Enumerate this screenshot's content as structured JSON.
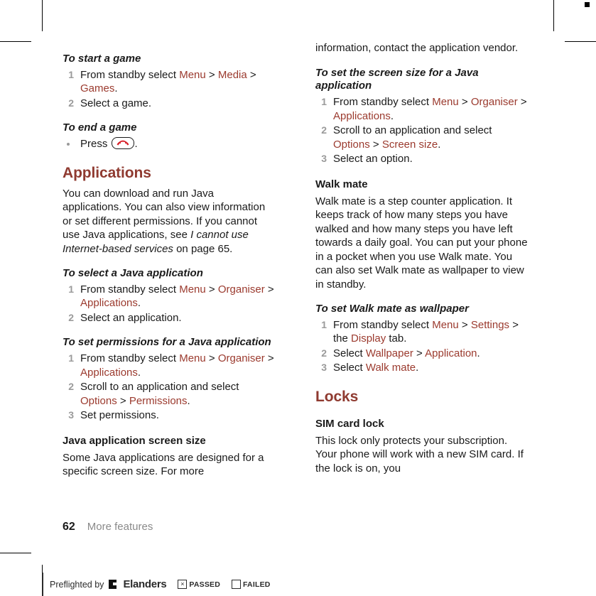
{
  "document": {
    "accent_color": "#9b3a2e",
    "heading_color": "#8f3a30",
    "step_number_color": "#9a9a9a"
  },
  "left_column": {
    "proc_start_game": {
      "title": "To start a game",
      "steps": [
        {
          "num": "1",
          "parts": [
            {
              "t": "From standby select ",
              "s": "plain"
            },
            {
              "t": "Menu",
              "s": "accent"
            },
            {
              "t": " > ",
              "s": "plain"
            },
            {
              "t": "Media",
              "s": "accent"
            },
            {
              "t": " > ",
              "s": "plain"
            },
            {
              "t": "Games",
              "s": "accent"
            },
            {
              "t": ".",
              "s": "plain"
            }
          ]
        },
        {
          "num": "2",
          "parts": [
            {
              "t": "Select a game.",
              "s": "plain"
            }
          ]
        }
      ]
    },
    "proc_end_game": {
      "title": "To end a game",
      "bullet_prefix": "Press ",
      "bullet_suffix": ".",
      "key_icon": "end-call-key-icon"
    },
    "applications_heading": "Applications",
    "applications_body": [
      {
        "t": "You can download and run Java applications. You can also view information or set different permissions. If you cannot use Java applications, see ",
        "s": "plain"
      },
      {
        "t": "I cannot use Internet-based services",
        "s": "italic"
      },
      {
        "t": " on page 65.",
        "s": "plain"
      }
    ],
    "proc_select_java": {
      "title": "To select a Java application",
      "steps": [
        {
          "num": "1",
          "parts": [
            {
              "t": "From standby select ",
              "s": "plain"
            },
            {
              "t": "Menu",
              "s": "accent"
            },
            {
              "t": " > ",
              "s": "plain"
            },
            {
              "t": "Organiser",
              "s": "accent"
            },
            {
              "t": " > ",
              "s": "plain"
            },
            {
              "t": "Applications",
              "s": "accent"
            },
            {
              "t": ".",
              "s": "plain"
            }
          ]
        },
        {
          "num": "2",
          "parts": [
            {
              "t": "Select an application.",
              "s": "plain"
            }
          ]
        }
      ]
    },
    "proc_set_permissions": {
      "title": "To set permissions for a Java application",
      "steps": [
        {
          "num": "1",
          "parts": [
            {
              "t": "From standby select ",
              "s": "plain"
            },
            {
              "t": "Menu",
              "s": "accent"
            },
            {
              "t": " > ",
              "s": "plain"
            },
            {
              "t": "Organiser",
              "s": "accent"
            },
            {
              "t": " > ",
              "s": "plain"
            },
            {
              "t": "Applications",
              "s": "accent"
            },
            {
              "t": ".",
              "s": "plain"
            }
          ]
        },
        {
          "num": "2",
          "parts": [
            {
              "t": "Scroll to an application and select ",
              "s": "plain"
            },
            {
              "t": "Options",
              "s": "accent"
            },
            {
              "t": " > ",
              "s": "plain"
            },
            {
              "t": "Permissions",
              "s": "accent"
            },
            {
              "t": ".",
              "s": "plain"
            }
          ]
        },
        {
          "num": "3",
          "parts": [
            {
              "t": "Set permissions.",
              "s": "plain"
            }
          ]
        }
      ]
    },
    "screen_size_heading": "Java application screen size",
    "screen_size_body": [
      {
        "t": "Some Java applications are designed for a specific screen size. For more",
        "s": "plain"
      }
    ]
  },
  "right_column": {
    "continuation_body": [
      {
        "t": "information, contact the application vendor.",
        "s": "plain"
      }
    ],
    "proc_set_screen_size": {
      "title": "To set the screen size for a Java application",
      "steps": [
        {
          "num": "1",
          "parts": [
            {
              "t": "From standby select ",
              "s": "plain"
            },
            {
              "t": "Menu",
              "s": "accent"
            },
            {
              "t": " > ",
              "s": "plain"
            },
            {
              "t": "Organiser",
              "s": "accent"
            },
            {
              "t": " > ",
              "s": "plain"
            },
            {
              "t": "Applications",
              "s": "accent"
            },
            {
              "t": ".",
              "s": "plain"
            }
          ]
        },
        {
          "num": "2",
          "parts": [
            {
              "t": "Scroll to an application and select ",
              "s": "plain"
            },
            {
              "t": "Options",
              "s": "accent"
            },
            {
              "t": " > ",
              "s": "plain"
            },
            {
              "t": "Screen size",
              "s": "accent"
            },
            {
              "t": ".",
              "s": "plain"
            }
          ]
        },
        {
          "num": "3",
          "parts": [
            {
              "t": "Select an option.",
              "s": "plain"
            }
          ]
        }
      ]
    },
    "walk_mate_heading": "Walk mate",
    "walk_mate_body": [
      {
        "t": "Walk mate is a step counter application. It keeps track of how many steps you have walked and how many steps you have left towards a daily goal. You can put your phone in a pocket when you use Walk mate. You can also set Walk mate as wallpaper to view in standby.",
        "s": "plain"
      }
    ],
    "proc_walk_mate_wallpaper": {
      "title": "To set Walk mate as wallpaper",
      "steps": [
        {
          "num": "1",
          "parts": [
            {
              "t": "From standby select ",
              "s": "plain"
            },
            {
              "t": "Menu",
              "s": "accent"
            },
            {
              "t": " > ",
              "s": "plain"
            },
            {
              "t": "Settings",
              "s": "accent"
            },
            {
              "t": " > the ",
              "s": "plain"
            },
            {
              "t": "Display",
              "s": "accent"
            },
            {
              "t": " tab.",
              "s": "plain"
            }
          ]
        },
        {
          "num": "2",
          "parts": [
            {
              "t": "Select ",
              "s": "plain"
            },
            {
              "t": "Wallpaper",
              "s": "accent"
            },
            {
              "t": " > ",
              "s": "plain"
            },
            {
              "t": "Application",
              "s": "accent"
            },
            {
              "t": ".",
              "s": "plain"
            }
          ]
        },
        {
          "num": "3",
          "parts": [
            {
              "t": "Select ",
              "s": "plain"
            },
            {
              "t": "Walk mate",
              "s": "accent"
            },
            {
              "t": ".",
              "s": "plain"
            }
          ]
        }
      ]
    },
    "locks_heading": "Locks",
    "sim_lock_heading": "SIM card lock",
    "sim_lock_body": [
      {
        "t": "This lock only protects your subscription. Your phone will work with a new SIM card. If the lock is on, you",
        "s": "plain"
      }
    ]
  },
  "footer": {
    "page_number": "62",
    "section_label": "More features"
  },
  "preflight": {
    "prefix": "Preflighted by",
    "company": "Elanders",
    "passed_mark": "×",
    "passed_label": "PASSED",
    "failed_mark": "",
    "failed_label": "FAILED"
  }
}
